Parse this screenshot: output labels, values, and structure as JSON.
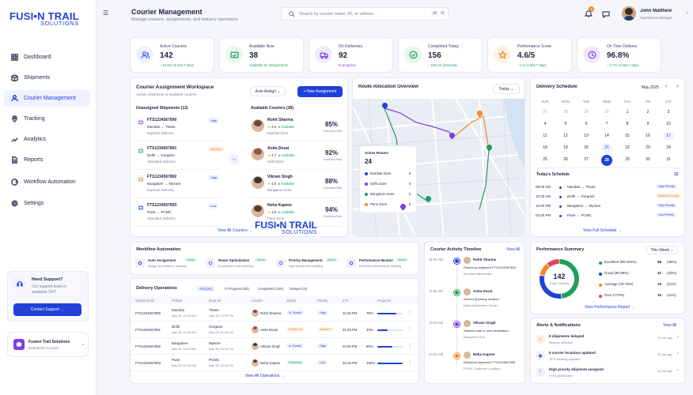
{
  "brand": {
    "line1": "FUSI•N TRAIL",
    "line2": "SOLUTIONS"
  },
  "nav": [
    {
      "label": "Dashboard"
    },
    {
      "label": "Shipments"
    },
    {
      "label": "Courier Management"
    },
    {
      "label": "Tracking"
    },
    {
      "label": "Analytics"
    },
    {
      "label": "Reports"
    },
    {
      "label": "Workflow Automation"
    },
    {
      "label": "Settings"
    }
  ],
  "support": {
    "title": "Need Support?",
    "text1": "Our support team is",
    "text2": "available 24/7",
    "button": "Contact Support"
  },
  "account": {
    "name": "Fusion Trail Solutions",
    "type": "Enterprise Account"
  },
  "header": {
    "title": "Courier Management",
    "subtitle": "Manage couriers, assignments, and delivery operations",
    "search_placeholder": "Search by courier name, ID, or vehicle...",
    "kbd1": "⌘",
    "kbd2": "K",
    "notif_count": "3",
    "user_name": "John Matthew",
    "user_role": "Operations Manager"
  },
  "kpis": [
    {
      "label": "Active Couriers",
      "value": "142",
      "delta": "↑ 10.5% vs last 7 days",
      "icon": "users-icon",
      "color": "#3b5bfd",
      "bg": "#eef1fe"
    },
    {
      "label": "Available Now",
      "value": "38",
      "delta": "Available for assignments",
      "icon": "truck-check-icon",
      "color": "#1ea05a",
      "bg": "#e8f7ee"
    },
    {
      "label": "On Deliveries",
      "value": "92",
      "delta": "In progress",
      "icon": "truck-icon",
      "color": "#7b3fe4",
      "bg": "#f1eafd"
    },
    {
      "label": "Completed Today",
      "value": "156",
      "delta": "↑ 18% vs yesterday",
      "icon": "check-circle-icon",
      "color": "#1ea05a",
      "bg": "#e8f7ee"
    },
    {
      "label": "Performance Score",
      "value": "4.6/5",
      "delta": "↑ 0.3 vs last 7 days",
      "icon": "star-icon",
      "color": "#f08a24",
      "bg": "#fef1e6"
    },
    {
      "label": "On Time Delivery",
      "value": "96.8%",
      "delta": "↑ 2.7% vs last 7 days",
      "icon": "clock-icon",
      "color": "#7b3fe4",
      "bg": "#f1eafd"
    }
  ],
  "workspace": {
    "title": "Courier Assignment Workspace",
    "subtitle": "Assign shipments to available couriers",
    "auto": "Auto Assign",
    "new_btn": "+ New Assignment",
    "unassigned_title": "Unassigned Shipments (12)",
    "available_title": "Available Couriers (38)",
    "view_all": "View All Couriers →"
  },
  "shipments": [
    {
      "id": "FTS1234567890",
      "route": "Mumbai → Thane",
      "type": "Express Delivery",
      "priority": "High"
    },
    {
      "id": "FTS1234567891",
      "route": "Delhi → Gurgaon",
      "type": "Standard Delivery",
      "priority": "Medium"
    },
    {
      "id": "FTS1234567892",
      "route": "Bangalore → Mysore",
      "type": "Express Delivery",
      "priority": "High"
    },
    {
      "id": "FTS1234567893",
      "route": "Pune → PCMC",
      "type": "Standard Delivery",
      "priority": "Low"
    }
  ],
  "couriers": [
    {
      "name": "Rohit Sharma",
      "rating": "4.6",
      "status": "Available",
      "zone": "Mumbai Zone",
      "rate": "85%",
      "rate_label": "Success Rate"
    },
    {
      "name": "Anita Desai",
      "rating": "4.7",
      "status": "Available",
      "zone": "Delhi Zone",
      "rate": "92%",
      "rate_label": "Success Rate"
    },
    {
      "name": "Vikram Singh",
      "rating": "4.5",
      "status": "Available",
      "zone": "Bangalore Zone",
      "rate": "88%",
      "rate_label": "Success Rate"
    },
    {
      "name": "Neha Kapoor",
      "rating": "4.8",
      "status": "Available",
      "zone": "Pune Zone",
      "rate": "94%",
      "rate_label": "Success Rate"
    }
  ],
  "watermark": {
    "line1": "FUSI•N TRAIL",
    "line2": "SOLUTIONS"
  },
  "route": {
    "title": "Route Allocation Overview",
    "period": "Today",
    "legend_title": "Active Routes",
    "total": "24",
    "zones": [
      {
        "name": "Mumbai Zone",
        "count": "8",
        "color": "#2140d8"
      },
      {
        "name": "Delhi Zone",
        "count": "6",
        "color": "#7b3fe4"
      },
      {
        "name": "Bangalore Zone",
        "count": "5",
        "color": "#1ea05a"
      },
      {
        "name": "Pune Zone",
        "count": "5",
        "color": "#f08a24"
      }
    ]
  },
  "schedule": {
    "title": "Delivery Schedule",
    "month": "May 2025",
    "days": [
      "SUN",
      "MON",
      "TUE",
      "WED",
      "THU",
      "FRI",
      "SAT"
    ],
    "cells": [
      "27",
      "28",
      "29",
      "30",
      "1",
      "2",
      "3",
      "4",
      "5",
      "6",
      "7",
      "8",
      "9",
      "10",
      "11",
      "12",
      "13",
      "14",
      "15",
      "16",
      "17",
      "18",
      "19",
      "20",
      "21",
      "22",
      "23",
      "24",
      "25",
      "26",
      "27",
      "28",
      "29",
      "30",
      "31"
    ],
    "today_title": "Today's Schedule",
    "today_count": "12",
    "items": [
      {
        "time": "09:00 AM",
        "route": "Mumbai → Thane",
        "tag": "High Priority"
      },
      {
        "time": "10:30 AM",
        "route": "Delhi → Gurgaon",
        "tag": "Medium Priority"
      },
      {
        "time": "12:00 PM",
        "route": "Bangalore → Mysore",
        "tag": "High Priority"
      },
      {
        "time": "02:00 PM",
        "route": "Pune → PCMC",
        "tag": "Low Priority"
      }
    ],
    "view_full": "View Full Schedule →"
  },
  "workflow": {
    "title": "Workflow Automation",
    "items": [
      {
        "name": "Auto Assignment",
        "desc": "Assign by location & capacity",
        "status": "Active"
      },
      {
        "name": "Route Optimization",
        "desc": "AI-powered route planning",
        "status": "Active"
      },
      {
        "name": "Priority Management",
        "desc": "High priority first handling",
        "status": "Active"
      },
      {
        "name": "Performance Monitor",
        "desc": "Real-time performance tracking",
        "status": "Active"
      }
    ]
  },
  "ops": {
    "title": "Delivery Operations",
    "tabs": [
      "All (124)",
      "In Progress (92)",
      "Completed (156)",
      "Delayed (8)"
    ],
    "cols": [
      "Shipment ID",
      "Pickup",
      "Drop-off",
      "Courier",
      "Status",
      "Priority",
      "ETA",
      "Progress"
    ],
    "rows": [
      {
        "id": "FTS1234567890",
        "pickup": "Mumbai",
        "pickup_date": "May 25, 09:00 AM",
        "drop": "Thane",
        "drop_date": "May 25, 12:00 PM",
        "courier": "Rohit Sharma",
        "status": "In Transit",
        "priority": "High",
        "eta": "12:40 PM",
        "progress": "75%",
        "pct": 0.75
      },
      {
        "id": "FTS1234567891",
        "pickup": "Delhi",
        "pickup_date": "May 25, 10:30 AM",
        "drop": "Gurgaon",
        "drop_date": "May 25, 01:30 PM",
        "courier": "Anita Desai",
        "status": "Picked Up",
        "priority": "Medium",
        "eta": "01:45 PM",
        "progress": "40%",
        "pct": 0.4
      },
      {
        "id": "FTS1234567892",
        "pickup": "Bangalore",
        "pickup_date": "May 25, 11:00 AM",
        "drop": "Mysore",
        "drop_date": "May 25, 05:00 PM",
        "courier": "Vikram Singh",
        "status": "In Transit",
        "priority": "High",
        "eta": "04:30 PM",
        "progress": "60%",
        "pct": 0.6
      },
      {
        "id": "FTS1234567893",
        "pickup": "Pune",
        "pickup_date": "May 25, 01:00 PM",
        "drop": "PCMC",
        "drop_date": "May 25, 02:30 PM",
        "courier": "Neha Kapoor",
        "status": "Delivered",
        "priority": "Low",
        "eta": "02:15 PM",
        "progress": "100%",
        "pct": 1.0
      }
    ],
    "view_all": "View All Operations →"
  },
  "timeline": {
    "title": "Courier Activity Timeline",
    "view_all": "View All",
    "items": [
      {
        "time": "11:30 AM",
        "name": "Rohit Sharma",
        "line1": "Picked up shipment FTS1234567890",
        "line2": "Mumbai Warehouse",
        "color": "#2140d8"
      },
      {
        "time": "11:05 AM",
        "name": "Anita Desai",
        "line1": "Arrived at pickup location",
        "line2": "Delhi Distribution Center",
        "color": "#1ea05a"
      },
      {
        "time": "10:45 AM",
        "name": "Vikram Singh",
        "line1": "Started route to next destination",
        "line2": "Bangalore Hub",
        "color": "#7b3fe4"
      },
      {
        "time": "10:30 AM",
        "name": "Neha Kapoor",
        "line1": "Delivered shipment FTS1234567893",
        "line2": "PCMC Customer Location",
        "color": "#f08a24"
      }
    ]
  },
  "performance": {
    "title": "Performance Summary",
    "period": "This Week",
    "total": "142",
    "total_label": "Total Couriers",
    "view": "View Performance Report →",
    "rows": [
      {
        "label": "Excellent (90-100%)",
        "count": "68",
        "pct": "(48%)",
        "color": "#1ea05a",
        "share": 0.48
      },
      {
        "label": "Good (80-89%)",
        "count": "42",
        "pct": "(30%)",
        "color": "#2140d8",
        "share": 0.3
      },
      {
        "label": "Average (70-79%)",
        "count": "16",
        "pct": "(11%)",
        "color": "#f08a24",
        "share": 0.11
      },
      {
        "label": "Poor (<70%)",
        "count": "16",
        "pct": "(11%)",
        "color": "#e2445c",
        "share": 0.11
      }
    ]
  },
  "alerts": {
    "title": "Alerts & Notifications",
    "view_all": "View All",
    "items": [
      {
        "title": "8 shipments delayed",
        "sub": "Require attention",
        "time": "10 min ago",
        "color": "#f08a24",
        "bg": "#fef1e6"
      },
      {
        "title": "5 courier locations updated",
        "sub": "GPS tracking updated",
        "time": "25 min ago",
        "color": "#2140d8",
        "bg": "#eef1fe"
      },
      {
        "title": "High priority shipment assigned",
        "sub": "FTS1234567894",
        "time": "40 min ago",
        "color": "#2140d8",
        "bg": "#eef1fe"
      }
    ]
  }
}
